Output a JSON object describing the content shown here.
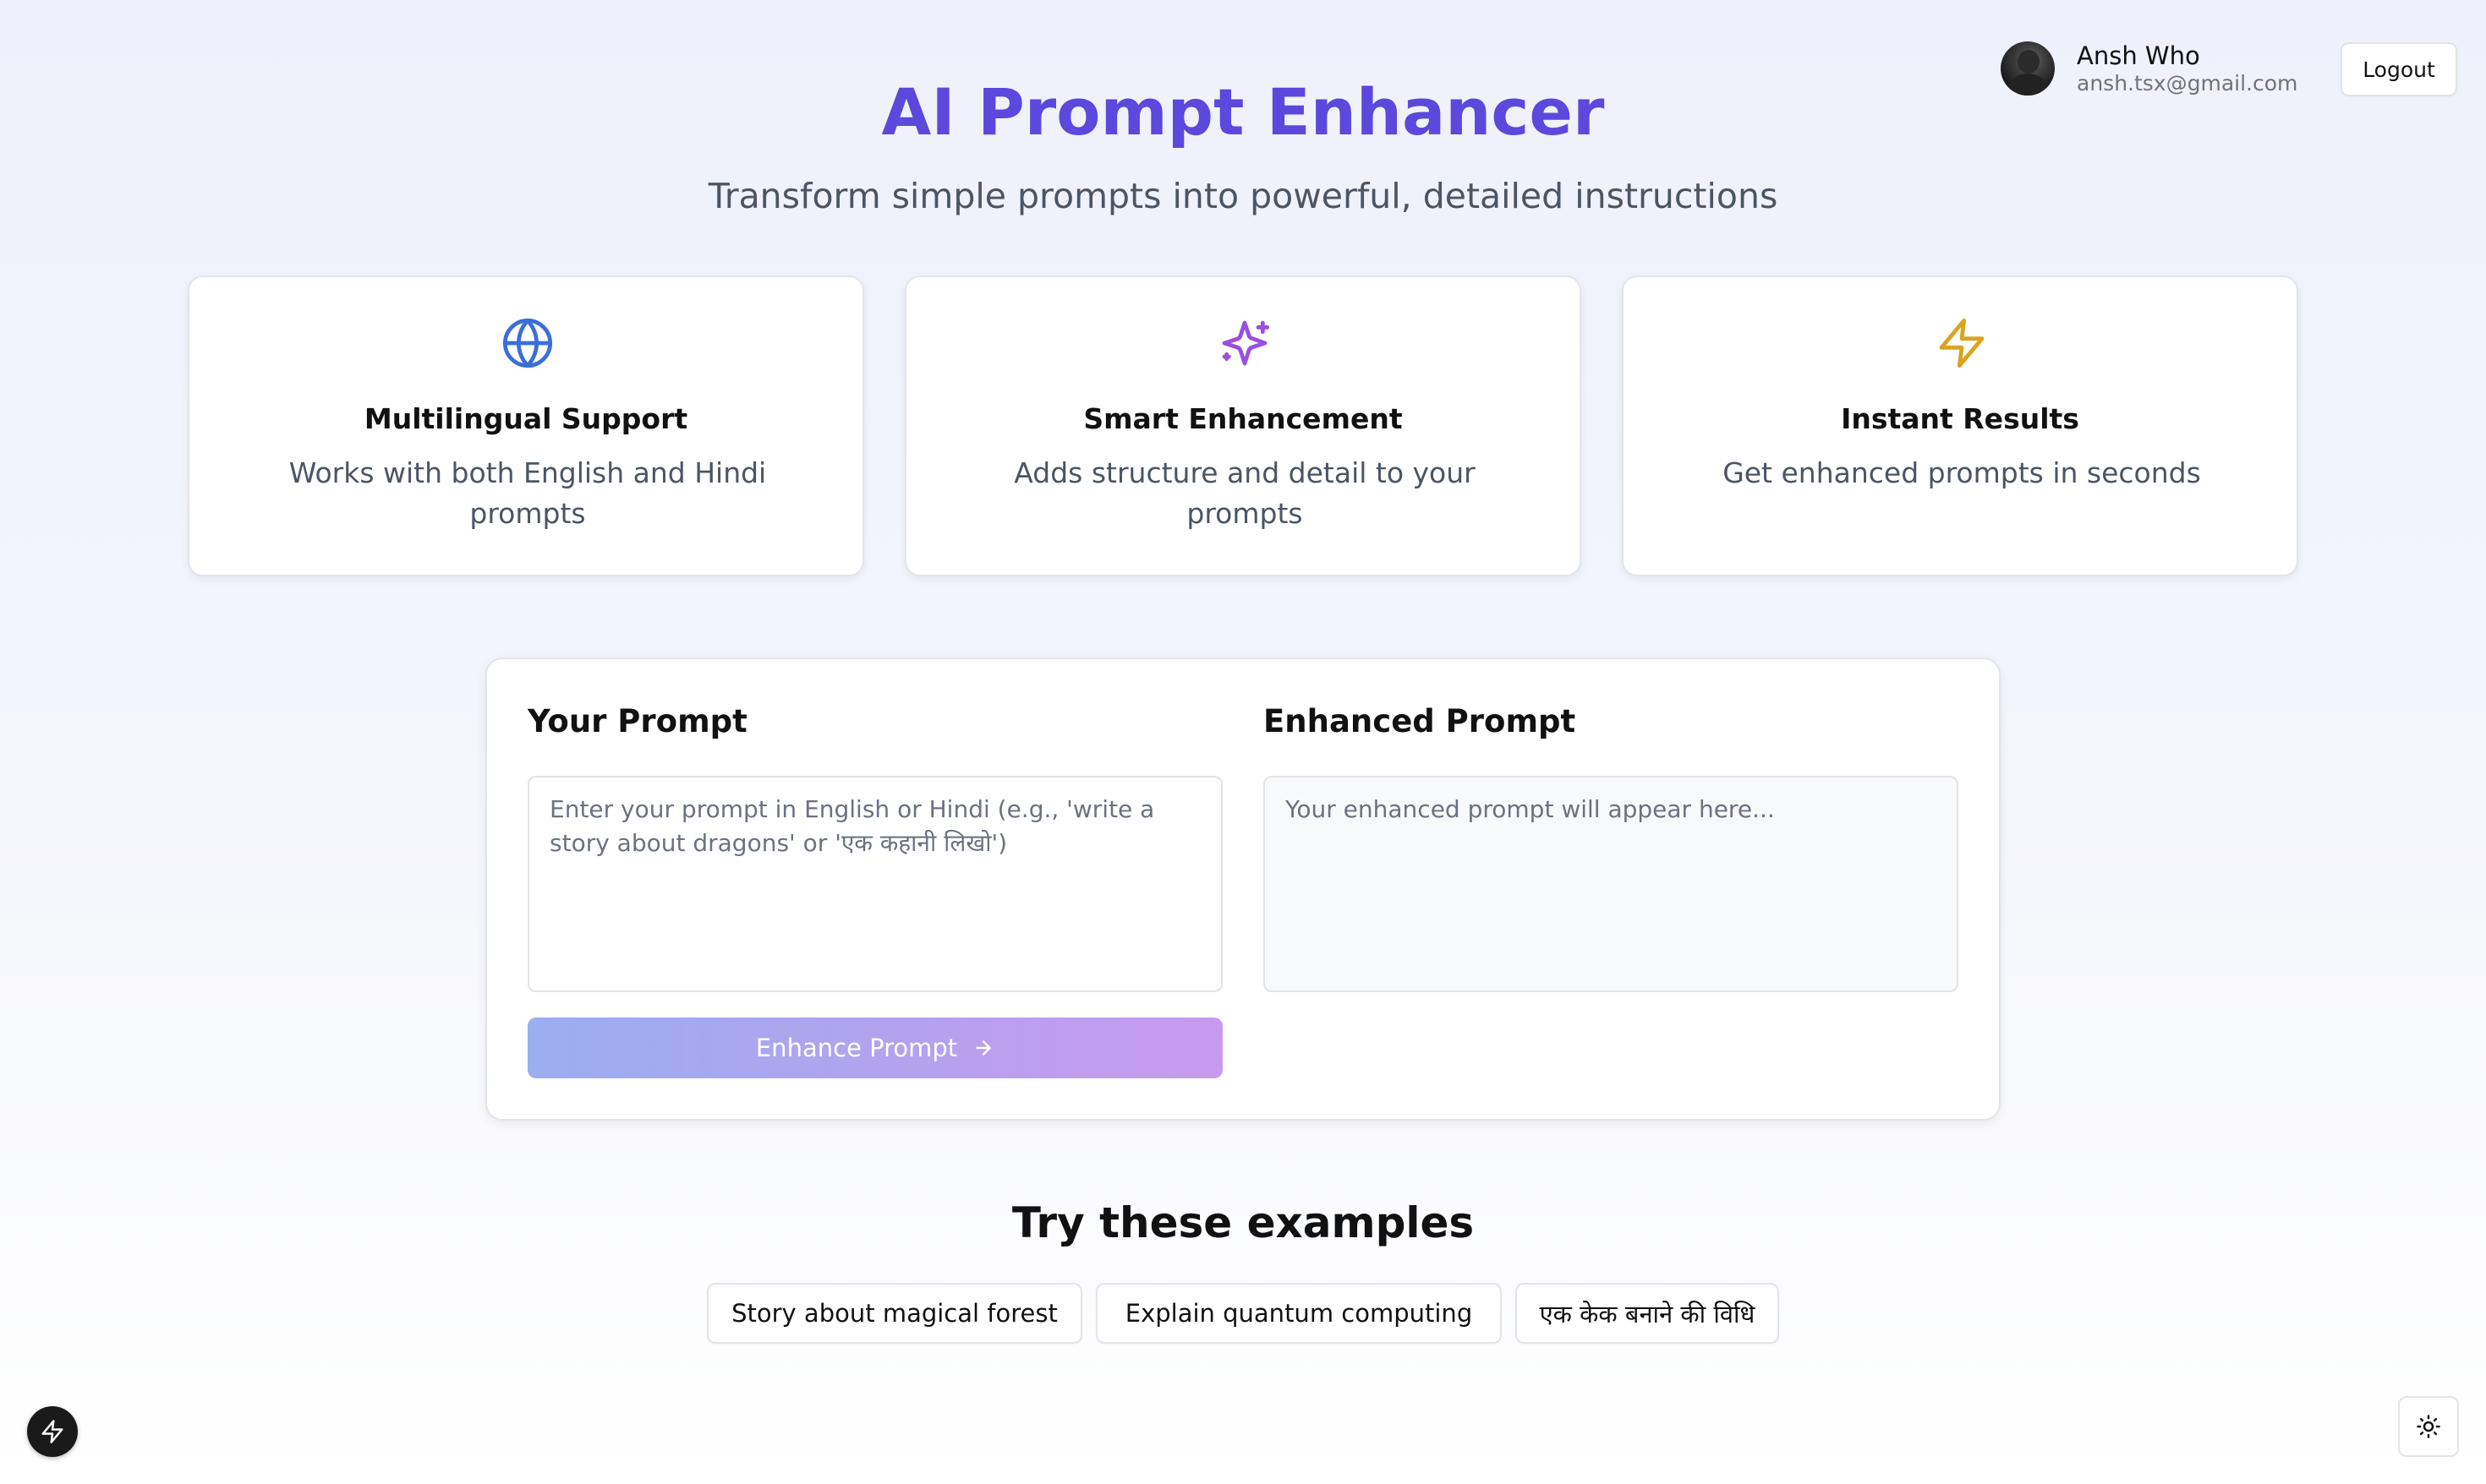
{
  "header": {
    "user_name": "Ansh Who",
    "user_email": "ansh.tsx@gmail.com",
    "logout_label": "Logout"
  },
  "hero": {
    "title": "AI Prompt Enhancer",
    "subtitle": "Transform simple prompts into powerful, detailed instructions"
  },
  "features": [
    {
      "icon": "globe-icon",
      "color": "#3b6fd8",
      "title": "Multilingual Support",
      "description": "Works with both English and Hindi prompts"
    },
    {
      "icon": "sparkles-icon",
      "color": "#9b4fe0",
      "title": "Smart Enhancement",
      "description": "Adds structure and detail to your prompts"
    },
    {
      "icon": "lightning-icon",
      "color": "#d9a520",
      "title": "Instant Results",
      "description": "Get enhanced prompts in seconds"
    }
  ],
  "prompt_panel": {
    "input_heading": "Your Prompt",
    "input_value": "",
    "input_placeholder": "Enter your prompt in English or Hindi (e.g., 'write a story about dragons' or 'एक कहानी लिखो')",
    "output_heading": "Enhanced Prompt",
    "output_value": "",
    "output_placeholder": "Your enhanced prompt will appear here...",
    "enhance_label": "Enhance Prompt"
  },
  "examples": {
    "title": "Try these examples",
    "items": [
      "Story about magical forest",
      "Explain quantum computing",
      "एक केक बनाने की विधि"
    ]
  },
  "corner": {
    "left_icon": "lightning-icon",
    "right_icon": "sun-icon"
  },
  "colors": {
    "accent": "#5b48dc",
    "button_gradient_start": "#9aaef0",
    "button_gradient_end": "#c89aee"
  }
}
